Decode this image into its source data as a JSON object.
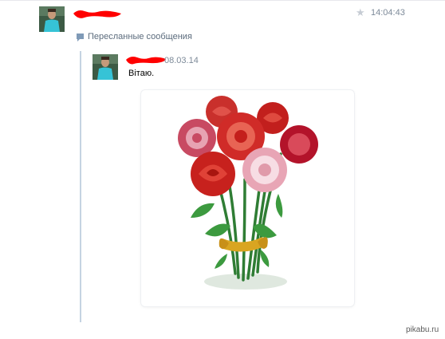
{
  "message": {
    "time": "14:04:43",
    "forwarded_label": "Пересланные сообщения"
  },
  "forwarded": {
    "date": "08.03.14",
    "text": "Вітаю."
  },
  "icons": {
    "star": "star-icon",
    "forwarded": "speech-bubble-icon",
    "photo": "rose-bouquet-image"
  },
  "watermark": "pikabu.ru",
  "colors": {
    "accent_bar": "#c5d3e2",
    "meta_text": "#7d8a99",
    "redaction": "#ff0000"
  }
}
